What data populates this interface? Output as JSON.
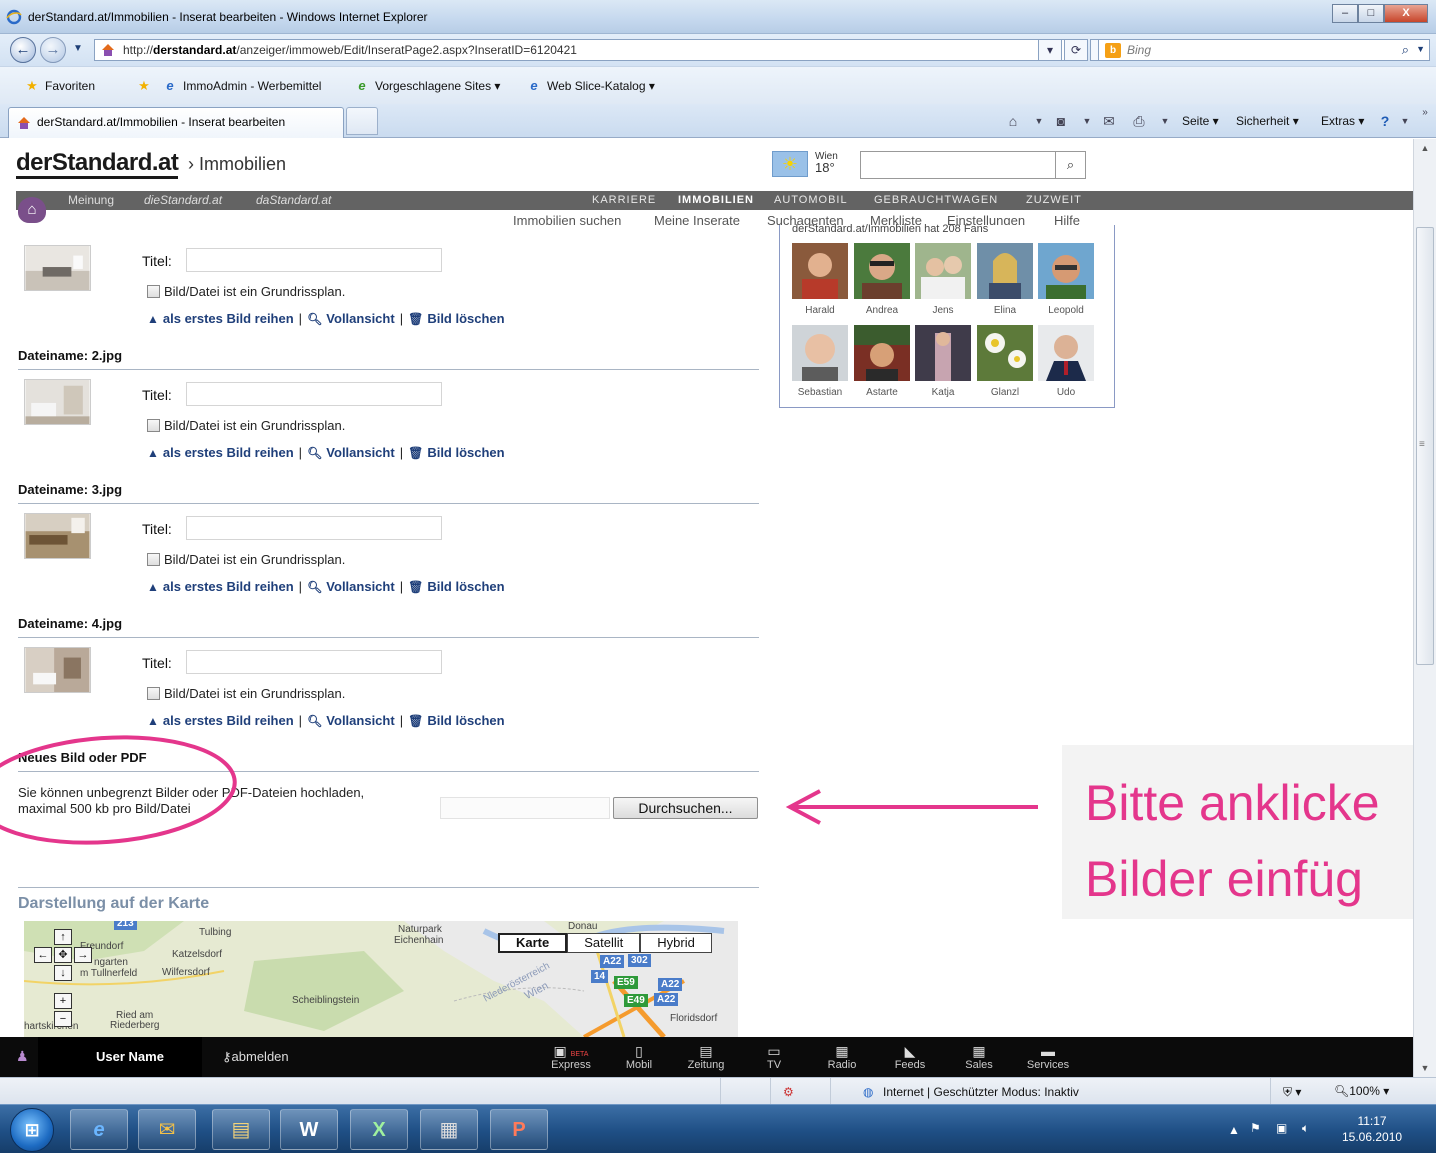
{
  "window": {
    "title": "derStandard.at/Immobilien - Inserat bearbeiten - Windows Internet Explorer",
    "minimize": "–",
    "maximize": "□",
    "close": "X"
  },
  "address": {
    "url_prefix": "http://",
    "url_host": "derstandard.at",
    "url_path": "/anzeiger/immoweb/Edit/InseratPage2.aspx?InseratID=6120421",
    "search_engine": "Bing"
  },
  "favorites": {
    "favoriten_label": "Favoriten",
    "items": [
      "ImmoAdmin - Werbemittel",
      "Vorgeschlagene Sites ▾",
      "Web Slice-Katalog ▾"
    ]
  },
  "tabs": {
    "active_label": "derStandard.at/Immobilien - Inserat bearbeiten"
  },
  "commandbar": {
    "seite": "Seite ▾",
    "sicherheit": "Sicherheit ▾",
    "extras": "Extras ▾"
  },
  "site": {
    "logo": "derStandard.at",
    "section": "› Immobilien",
    "weather_city": "Wien",
    "weather_temp": "18°",
    "nav_left": [
      "Meinung",
      "dieStandard.at",
      "daStandard.at"
    ],
    "nav_caps": [
      "KARRIERE",
      "IMMOBILIEN",
      "AUTOMOBIL",
      "GEBRAUCHTWAGEN",
      "ZUZWEIT"
    ],
    "subnav": [
      "Immobilien suchen",
      "Meine Inserate",
      "Suchagenten",
      "Merkliste",
      "Einstellungen",
      "Hilfe"
    ]
  },
  "images": {
    "title_label": "Titel:",
    "checkbox_label": "Bild/Datei ist ein Grundrissplan.",
    "action_first": "als erstes Bild reihen",
    "action_view": "Vollansicht",
    "action_delete": "Bild löschen",
    "separator": "|",
    "filenames": [
      "Dateiname: 2.jpg",
      "Dateiname: 3.jpg",
      "Dateiname: 4.jpg"
    ]
  },
  "upload": {
    "heading": "Neues Bild oder PDF",
    "line1": "Sie können unbegrenzt Bilder oder PDF-Dateien hochladen,",
    "line2": "maximal 500 kb pro Bild/Datei",
    "browse_label": "Durchsuchen..."
  },
  "map": {
    "title": "Darstellung auf der Karte",
    "type_buttons": [
      "Karte",
      "Satellit",
      "Hybrid"
    ],
    "labels": [
      "Tulbing",
      "Freundorf",
      "Katzelsdorf",
      "Wilfersdorf",
      "Naturpark",
      "Eichenhain",
      "Donau",
      "Niederösterreich",
      "Wien",
      "Scheiblingstein",
      "Ried am",
      "Riederberg",
      "hartskirchen",
      "Floridsdorf",
      "ngarten",
      "m Tullnerfeld"
    ],
    "roads": [
      "A22",
      "302",
      "14",
      "E59",
      "A22",
      "E49",
      "A22",
      "213"
    ]
  },
  "fans": {
    "header": "derStandard.at/Immobilien hat 208 Fans",
    "names": [
      "Harald",
      "Andrea",
      "Jens",
      "Elina",
      "Leopold",
      "Sebastian",
      "Astarte",
      "Katja",
      "Glanzl",
      "Udo"
    ]
  },
  "annotation": {
    "line1": "Bitte anklicke",
    "line2": "Bilder einfüg",
    "color": "#e4368c"
  },
  "dsbar": {
    "user": "User Name",
    "logout": "abmelden",
    "items": [
      "Express",
      "Mobil",
      "Zeitung",
      "TV",
      "Radio",
      "Feeds",
      "Sales",
      "Services"
    ],
    "beta": "BETA"
  },
  "status": {
    "zone": "Internet | Geschützter Modus: Inaktiv",
    "zoom": "100%"
  },
  "clock": {
    "time": "11:17",
    "date": "15.06.2010"
  }
}
